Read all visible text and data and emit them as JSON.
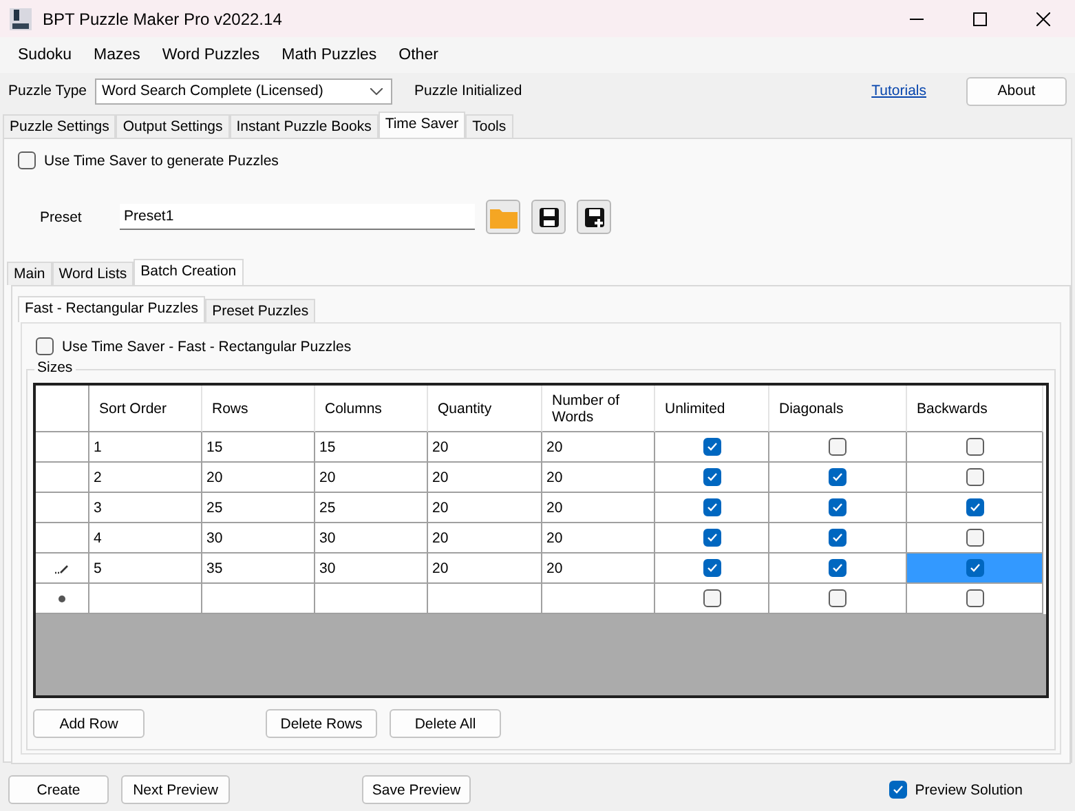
{
  "window": {
    "title": "BPT Puzzle Maker Pro v2022.14"
  },
  "menu": [
    "Sudoku",
    "Mazes",
    "Word Puzzles",
    "Math Puzzles",
    "Other"
  ],
  "puzzle_type": {
    "label": "Puzzle Type",
    "value": "Word Search Complete (Licensed)",
    "status": "Puzzle Initialized"
  },
  "tutorials_link": "Tutorials",
  "about_button": "About",
  "tabs": [
    {
      "label": "Puzzle Settings",
      "selected": false
    },
    {
      "label": "Output Settings",
      "selected": false
    },
    {
      "label": "Instant Puzzle Books",
      "selected": false
    },
    {
      "label": "Time Saver",
      "selected": true
    },
    {
      "label": "Tools",
      "selected": false
    }
  ],
  "use_time_saver": {
    "label": "Use Time Saver to generate Puzzles",
    "checked": false
  },
  "preset": {
    "label": "Preset",
    "value": "Preset1"
  },
  "inner_tabs": [
    {
      "label": "Main",
      "selected": false
    },
    {
      "label": "Word Lists",
      "selected": false
    },
    {
      "label": "Batch Creation",
      "selected": true
    }
  ],
  "sub_tabs": [
    {
      "label": "Fast - Rectangular Puzzles",
      "selected": true
    },
    {
      "label": "Preset Puzzles",
      "selected": false
    }
  ],
  "use_fast": {
    "label": "Use Time Saver - Fast - Rectangular Puzzles",
    "checked": false
  },
  "sizes": {
    "title": "Sizes",
    "columns": [
      "Sort Order",
      "Rows",
      "Columns",
      "Quantity",
      "Number of Words",
      "Unlimited",
      "Diagonals",
      "Backwards"
    ],
    "rows": [
      {
        "kind": "data",
        "cells": [
          "1",
          "15",
          "15",
          "20",
          "20"
        ],
        "checks": [
          {
            "checked": true,
            "selected": false
          },
          {
            "checked": false,
            "selected": false
          },
          {
            "checked": false,
            "selected": false
          }
        ]
      },
      {
        "kind": "data",
        "cells": [
          "2",
          "20",
          "20",
          "20",
          "20"
        ],
        "checks": [
          {
            "checked": true,
            "selected": false
          },
          {
            "checked": true,
            "selected": false
          },
          {
            "checked": false,
            "selected": false
          }
        ]
      },
      {
        "kind": "data",
        "cells": [
          "3",
          "25",
          "25",
          "20",
          "20"
        ],
        "checks": [
          {
            "checked": true,
            "selected": false
          },
          {
            "checked": true,
            "selected": false
          },
          {
            "checked": true,
            "selected": false
          }
        ]
      },
      {
        "kind": "data",
        "cells": [
          "4",
          "30",
          "30",
          "20",
          "20"
        ],
        "checks": [
          {
            "checked": true,
            "selected": false
          },
          {
            "checked": true,
            "selected": false
          },
          {
            "checked": false,
            "selected": false
          }
        ]
      },
      {
        "kind": "editing",
        "cells": [
          "5",
          "35",
          "30",
          "20",
          "20"
        ],
        "checks": [
          {
            "checked": true,
            "selected": false
          },
          {
            "checked": true,
            "selected": false
          },
          {
            "checked": true,
            "selected": true
          }
        ]
      },
      {
        "kind": "new",
        "checks": [
          {
            "checked": false,
            "selected": false
          },
          {
            "checked": false,
            "selected": false
          },
          {
            "checked": false,
            "selected": false
          }
        ]
      }
    ]
  },
  "grid_buttons": [
    "Add Row",
    "Delete Rows",
    "Delete All"
  ],
  "bottom_buttons": [
    "Create",
    "Next Preview",
    "Save Preview"
  ],
  "preview_solution": {
    "label": "Preview Solution",
    "checked": true
  }
}
